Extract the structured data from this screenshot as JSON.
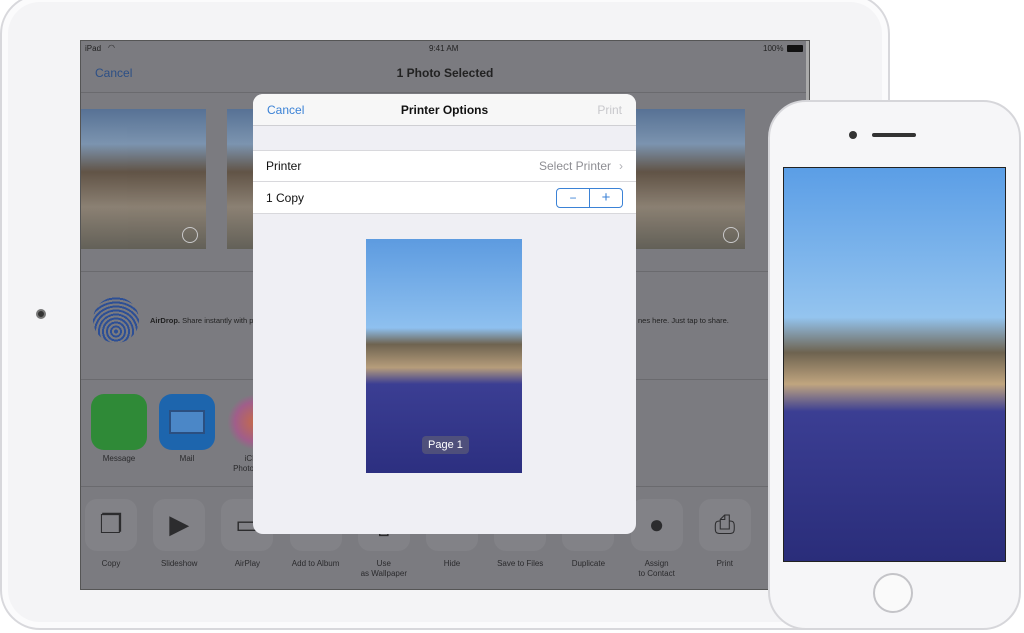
{
  "ipad": {
    "status": {
      "device": "iPad",
      "time": "9:41 AM",
      "battery": "100%"
    },
    "nav": {
      "cancel": "Cancel",
      "title": "1 Photo Selected"
    },
    "airdrop": {
      "bold": "AirDrop.",
      "text_left": "Share instantly with p",
      "text_right": "nes here. Just tap to share."
    },
    "apps": [
      {
        "label": "Message",
        "icon": "message-icon",
        "color": "#2fa83a"
      },
      {
        "label": "Mail",
        "icon": "mail-icon",
        "color": "#1f7ed8"
      },
      {
        "label": "iCl",
        "label2": "Photo",
        "icon": "photos-icon"
      }
    ],
    "actions": [
      {
        "label": "Copy",
        "icon": "copy-icon"
      },
      {
        "label": "Slideshow",
        "icon": "play-icon"
      },
      {
        "label": "AirPlay",
        "icon": "airplay-icon"
      },
      {
        "label": "Add to Album",
        "icon": "album-icon"
      },
      {
        "label": "Use",
        "label2": "as Wallpaper",
        "icon": "wallpaper-icon"
      },
      {
        "label": "Hide",
        "icon": "hide-icon"
      },
      {
        "label": "Save to Files",
        "icon": "folder-icon"
      },
      {
        "label": "Duplicate",
        "icon": "duplicate-icon"
      },
      {
        "label": "Assign",
        "label2": "to Contact",
        "icon": "contact-icon"
      },
      {
        "label": "Print",
        "icon": "printer-icon"
      }
    ]
  },
  "printer_options": {
    "cancel": "Cancel",
    "title": "Printer Options",
    "print": "Print",
    "printer_label": "Printer",
    "printer_value": "Select Printer",
    "copies_label": "1 Copy",
    "minus": "−",
    "plus": "+",
    "page_badge": "Page 1"
  },
  "colors": {
    "accent": "#1a7cf0"
  }
}
